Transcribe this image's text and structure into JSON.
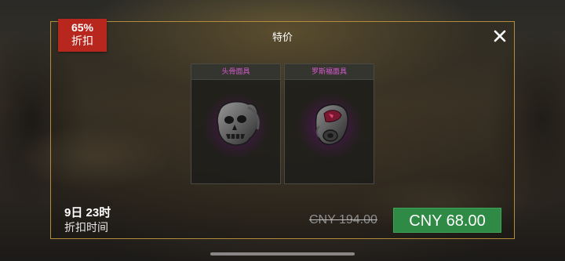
{
  "offer": {
    "discount_percent": "65%",
    "discount_label": "折扣",
    "title": "特价",
    "close_icon": "close-icon"
  },
  "items": [
    {
      "name": "头骨面具",
      "icon": "skull-mask-icon"
    },
    {
      "name": "罗斯福面具",
      "icon": "gas-mask-icon"
    }
  ],
  "timer": {
    "value": "9日 23时",
    "caption": "折扣时间"
  },
  "pricing": {
    "original_price": "CNY 194.00",
    "sale_price": "CNY 68.00"
  },
  "colors": {
    "badge": "#b8271e",
    "buy_button": "#2e8a44",
    "item_name": "#d85ad0",
    "panel_border": "#b48d3c"
  }
}
